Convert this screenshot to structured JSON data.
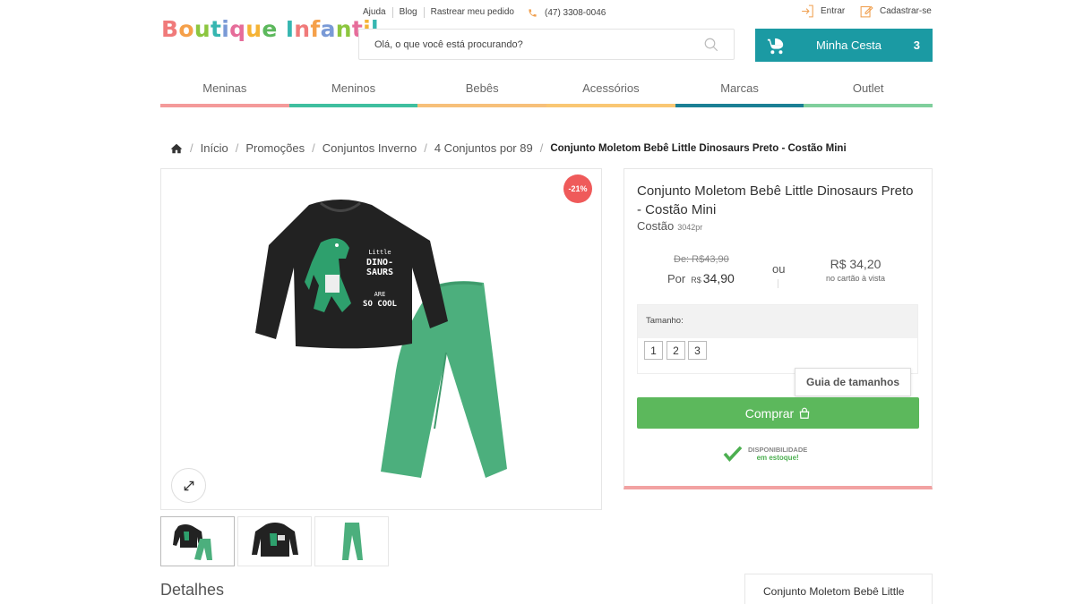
{
  "header": {
    "logo_text": "Boutique Infantil",
    "logo_letters": [
      {
        "ch": "B",
        "color": "#f07a7a"
      },
      {
        "ch": "o",
        "color": "#f5a04a"
      },
      {
        "ch": "u",
        "color": "#8cc63f"
      },
      {
        "ch": "t",
        "color": "#36b6b0"
      },
      {
        "ch": "i",
        "color": "#7a9ad6"
      },
      {
        "ch": "q",
        "color": "#e66d9a"
      },
      {
        "ch": "u",
        "color": "#f5b335"
      },
      {
        "ch": "e",
        "color": "#5cb85c"
      },
      {
        "ch": " ",
        "color": "#fff"
      },
      {
        "ch": "I",
        "color": "#36b6b0"
      },
      {
        "ch": "n",
        "color": "#f07a7a"
      },
      {
        "ch": "f",
        "color": "#f5a04a"
      },
      {
        "ch": "a",
        "color": "#7a9ad6"
      },
      {
        "ch": "n",
        "color": "#8cc63f"
      },
      {
        "ch": "t",
        "color": "#e66d9a"
      },
      {
        "ch": "i",
        "color": "#f5b335"
      },
      {
        "ch": "l",
        "color": "#36b6b0"
      }
    ],
    "top_links": [
      "Ajuda",
      "Blog",
      "Rastrear meu pedido"
    ],
    "phone": "(47) 3308-0046",
    "login": "Entrar",
    "register": "Cadastrar-se",
    "search_placeholder": "Olá, o que você está procurando?",
    "cart_label": "Minha Cesta",
    "cart_count": "3"
  },
  "categories": [
    {
      "label": "Meninas",
      "color": "#f49a9a"
    },
    {
      "label": "Meninos",
      "color": "#3fbf9f"
    },
    {
      "label": "Bebês",
      "color": "#f7c07a"
    },
    {
      "label": "Acessórios",
      "color": "#f9c773"
    },
    {
      "label": "Marcas",
      "color": "#1b7f95"
    },
    {
      "label": "Outlet",
      "color": "#7fcf9c"
    }
  ],
  "breadcrumb": {
    "items": [
      "Início",
      "Promoções",
      "Conjuntos Inverno",
      "4 Conjuntos por 89"
    ],
    "current": "Conjunto Moletom Bebê Little Dinosaurs Preto - Costão Mini"
  },
  "product": {
    "discount_badge": "-21%",
    "shirt_text": [
      "Little",
      "DINO-",
      "SAURS",
      "ARE",
      "SO COOL"
    ],
    "title": "Conjunto Moletom Bebê Little Dinosaurs Preto - Costão Mini",
    "brand": "Costão",
    "sku": "3042pr",
    "old_price": "De: R$43,90",
    "por_label": "Por",
    "currency": "R$",
    "price": "34,90",
    "or_label": "ou",
    "cash_price": "R$ 34,20",
    "cash_note": "no cartão à vista",
    "size_label": "Tamanho:",
    "sizes": [
      "1",
      "2",
      "3"
    ],
    "size_guide": "Guia de tamanhos",
    "buy_label": "Comprar",
    "availability_label": "DISPONIBILIDADE",
    "availability_value": "em estoque!"
  },
  "details": {
    "heading": "Detalhes",
    "side_card": "Conjunto Moletom Bebê Little"
  },
  "colors": {
    "accent_teal": "#1b9aa3",
    "buy_green": "#5cb85c",
    "badge_red": "#ef5a5a",
    "pants_green": "#4caf7d",
    "shirt_black": "#222222"
  }
}
